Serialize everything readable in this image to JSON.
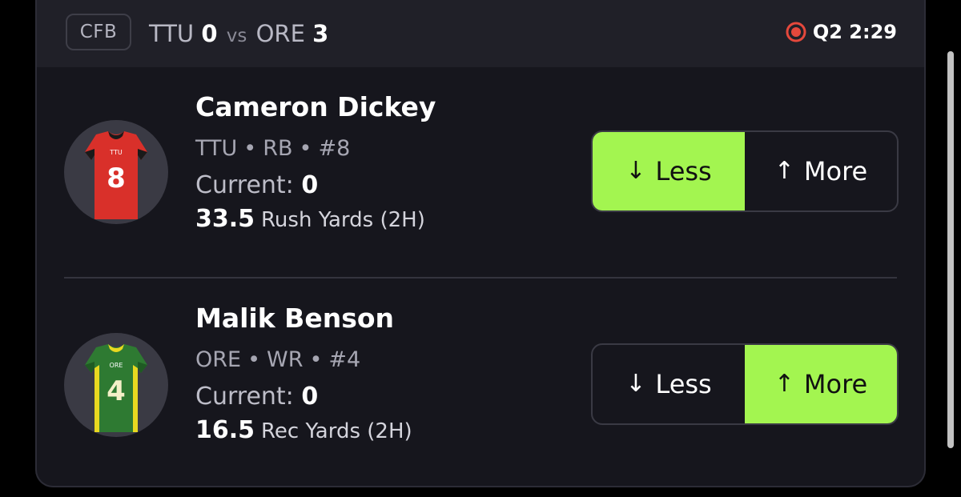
{
  "header": {
    "league": "CFB",
    "away_team": "TTU",
    "away_score": "0",
    "vs": "vs",
    "home_team": "ORE",
    "home_score": "3",
    "live_icon": "live-record-icon",
    "clock": "Q2 2:29"
  },
  "picks": [
    {
      "name": "Cameron Dickey",
      "team": "TTU",
      "position": "RB",
      "number": "#8",
      "separator": "•",
      "current_label": "Current:",
      "current_value": "0",
      "line": "33.5",
      "stat": "Rush Yards (2H)",
      "less_label": "Less",
      "more_label": "More",
      "selected": "less",
      "jersey": {
        "number": "8",
        "team_text": "TTU",
        "primary": "#d9302a",
        "trim": "#1a1a1a"
      }
    },
    {
      "name": "Malik Benson",
      "team": "ORE",
      "position": "WR",
      "number": "#4",
      "separator": "•",
      "current_label": "Current:",
      "current_value": "0",
      "line": "16.5",
      "stat": "Rec Yards (2H)",
      "less_label": "Less",
      "more_label": "More",
      "selected": "more",
      "jersey": {
        "number": "4",
        "team_text": "ORE",
        "primary": "#2e7a32",
        "trim": "#e8d820"
      }
    }
  ],
  "colors": {
    "selected_bg": "#a3f550",
    "card_bg": "#16161d",
    "header_bg": "#202028",
    "live_red": "#e5483c"
  }
}
